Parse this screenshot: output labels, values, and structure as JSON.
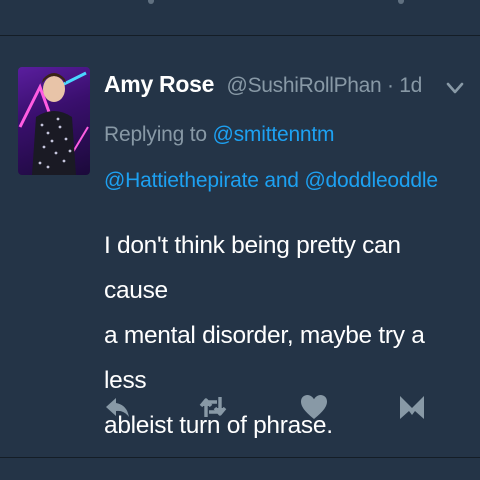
{
  "tweet": {
    "display_name": "Amy Rose",
    "handle": "@SushiRollPhan",
    "time": "· 1d",
    "replying_prefix": "Replying to",
    "replying_to": [
      "@smittenntm",
      "@Hattiethepirate",
      "@doddleoddle"
    ],
    "replying_and": "and",
    "body_lines": [
      "I don't think being pretty can cause",
      "a mental disorder, maybe try a less",
      "ableist turn of phrase."
    ]
  },
  "actions": [
    "reply-icon",
    "retweet-icon",
    "like-icon",
    "direct-message-icon"
  ],
  "colors": {
    "background": "#243447",
    "divider": "#141d26",
    "link": "#1da1f2",
    "muted": "#8899a6",
    "text": "#ffffff"
  }
}
